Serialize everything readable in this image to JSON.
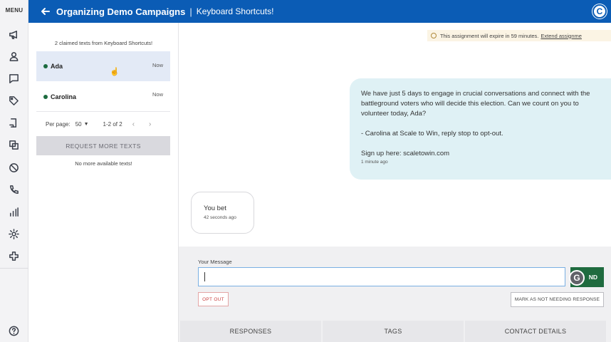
{
  "rail": {
    "menu_label": "MENU",
    "icons": [
      "megaphone-icon",
      "person-icon",
      "chat-icon",
      "tag-icon",
      "document-icon",
      "copy-icon",
      "block-icon",
      "phone-icon",
      "bar-chart-icon",
      "gear-icon",
      "plus-icon",
      "help-icon"
    ]
  },
  "header": {
    "title": "Organizing Demo Campaigns",
    "separator": "|",
    "subtitle": "Keyboard Shortcuts!",
    "avatar_letter": "C",
    "color": "#0b5cb5"
  },
  "list": {
    "claimed_text": "2 claimed texts from Keyboard Shortcuts!",
    "contacts": [
      {
        "name": "Ada",
        "time": "Now"
      },
      {
        "name": "Carolina",
        "time": "Now"
      }
    ],
    "pager": {
      "label": "Per page:",
      "value": "50",
      "range": "1-2 of 2"
    },
    "request_button": "REQUEST MORE TEXTS",
    "no_more": "No more available texts!"
  },
  "messages": {
    "expire_notice": "This assignment will expire in 59 minutes.",
    "expire_link": "Extend assignme",
    "outgoing": {
      "para1": "We have just 5 days to engage in crucial conversations and connect with the battleground voters who will decide this election. Can we count on you to volunteer today, Ada?",
      "para2": "- Carolina at Scale to Win, reply stop to opt-out.",
      "para3": "Sign up here: scaletowin.com",
      "time": "1 minute ago"
    },
    "incoming": {
      "text": "You bet",
      "time": "42 seconds ago"
    }
  },
  "composer": {
    "label": "Your Message",
    "value": "",
    "send_label": "ND",
    "grammarly_letter": "G",
    "opt_out": "OPT OUT",
    "mark_not_needing": "MARK AS NOT NEEDING RESPONSE"
  },
  "tabs": [
    "RESPONSES",
    "TAGS",
    "CONTACT DETAILS"
  ]
}
